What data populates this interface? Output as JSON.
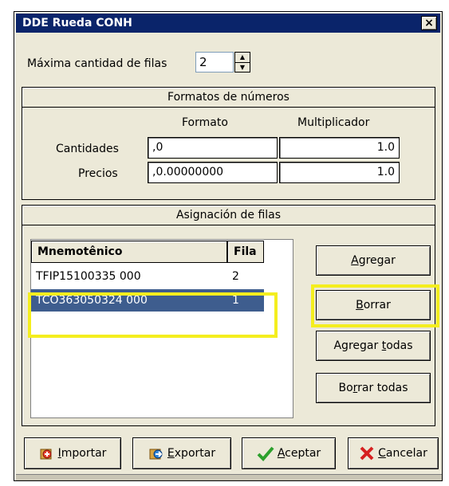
{
  "window": {
    "title": "DDE Rueda CONH",
    "close_glyph": "×"
  },
  "max_rows": {
    "label": "Máxima cantidad de filas",
    "value": "2"
  },
  "number_formats": {
    "header": "Formatos de números",
    "col_format": "Formato",
    "col_multiplier": "Multiplicador",
    "rows": [
      {
        "label": "Cantidades",
        "format": ",0",
        "multiplier": "1.0"
      },
      {
        "label": "Precios",
        "format": ",0.00000000",
        "multiplier": "1.0"
      }
    ]
  },
  "row_assignment": {
    "header": "Asignación de filas",
    "columns": [
      "Mnemotênico",
      "Fila"
    ],
    "rows": [
      {
        "mnemonic": "TFIP15100335 000",
        "row": "2",
        "selected": false
      },
      {
        "mnemonic": "TCO363050324 000",
        "row": "1",
        "selected": true
      }
    ],
    "buttons": {
      "add_first": "A",
      "add_rest": "gregar",
      "delete_first": "B",
      "delete_rest": "orrar",
      "add_all_pre": "Agregar ",
      "add_all_u": "t",
      "add_all_post": "odas",
      "delete_all_pre": "Bo",
      "delete_all_u": "r",
      "delete_all_post": "rar todas"
    }
  },
  "footer": {
    "import_u": "I",
    "import_rest": "mportar",
    "export_u": "E",
    "export_rest": "xportar",
    "accept_u": "A",
    "accept_rest": "ceptar",
    "cancel_u": "C",
    "cancel_rest": "ancelar"
  },
  "colors": {
    "title_bar": "#0a246a",
    "selection": "#3e5d8e",
    "highlight": "#f4ee1e",
    "accept_check": "#2ca02c",
    "cancel_x": "#d62020"
  },
  "icons": [
    "close-icon",
    "spin-up-icon",
    "spin-down-icon",
    "import-icon",
    "export-icon",
    "check-icon",
    "x-icon"
  ]
}
